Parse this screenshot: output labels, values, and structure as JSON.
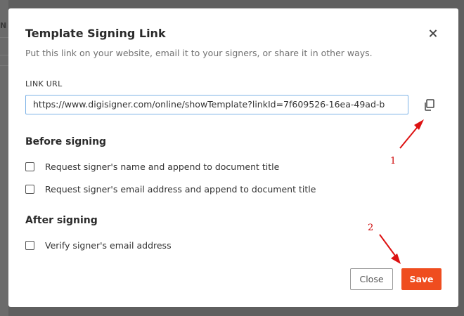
{
  "background": {
    "partial_text": "N"
  },
  "dialog": {
    "title": "Template Signing Link",
    "subtitle": "Put this link on your website, email it to your signers, or share it in other ways.",
    "link_url": {
      "label": "LINK URL",
      "value": "https://www.digisigner.com/online/showTemplate?linkId=7f609526-16ea-49ad-b"
    },
    "before_signing": {
      "heading": "Before signing",
      "options": [
        {
          "label": "Request signer's name and append to document title",
          "checked": false
        },
        {
          "label": "Request signer's email address and append to document title",
          "checked": false
        }
      ]
    },
    "after_signing": {
      "heading": "After signing",
      "options": [
        {
          "label": "Verify signer's email address",
          "checked": false
        }
      ]
    },
    "buttons": {
      "close": "Close",
      "save": "Save"
    }
  },
  "annotations": {
    "step1": "1",
    "step2": "2"
  },
  "colors": {
    "save_button": "#ef4d1f",
    "input_border": "#7db3e6",
    "annotation": "#cc0000",
    "overlay": "#5f5f5f"
  },
  "icons": {
    "close": "close-icon",
    "copy": "copy-icon"
  }
}
